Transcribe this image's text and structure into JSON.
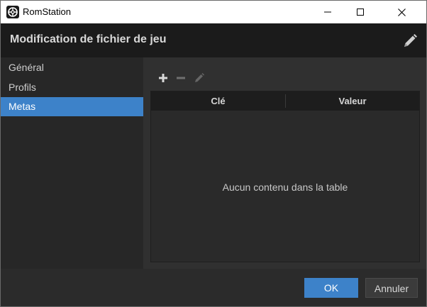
{
  "window": {
    "title": "RomStation",
    "app_icon": "romstation-logo-icon"
  },
  "header": {
    "title": "Modification de fichier de jeu",
    "action_icon": "pencil-icon"
  },
  "sidebar": {
    "items": [
      {
        "label": "Général",
        "active": false
      },
      {
        "label": "Profils",
        "active": false
      },
      {
        "label": "Metas",
        "active": true
      }
    ]
  },
  "toolbar": {
    "add_icon": "plus-icon",
    "remove_icon": "minus-icon",
    "edit_icon": "pencil-icon"
  },
  "table": {
    "columns": [
      "Clé",
      "Valeur"
    ],
    "rows": [],
    "empty_text": "Aucun contenu dans la table"
  },
  "footer": {
    "ok_label": "OK",
    "cancel_label": "Annuler"
  },
  "colors": {
    "accent": "#3d82c9",
    "header_bg": "#1b1b1b",
    "sidebar_bg": "#272727",
    "main_bg": "#303030"
  }
}
